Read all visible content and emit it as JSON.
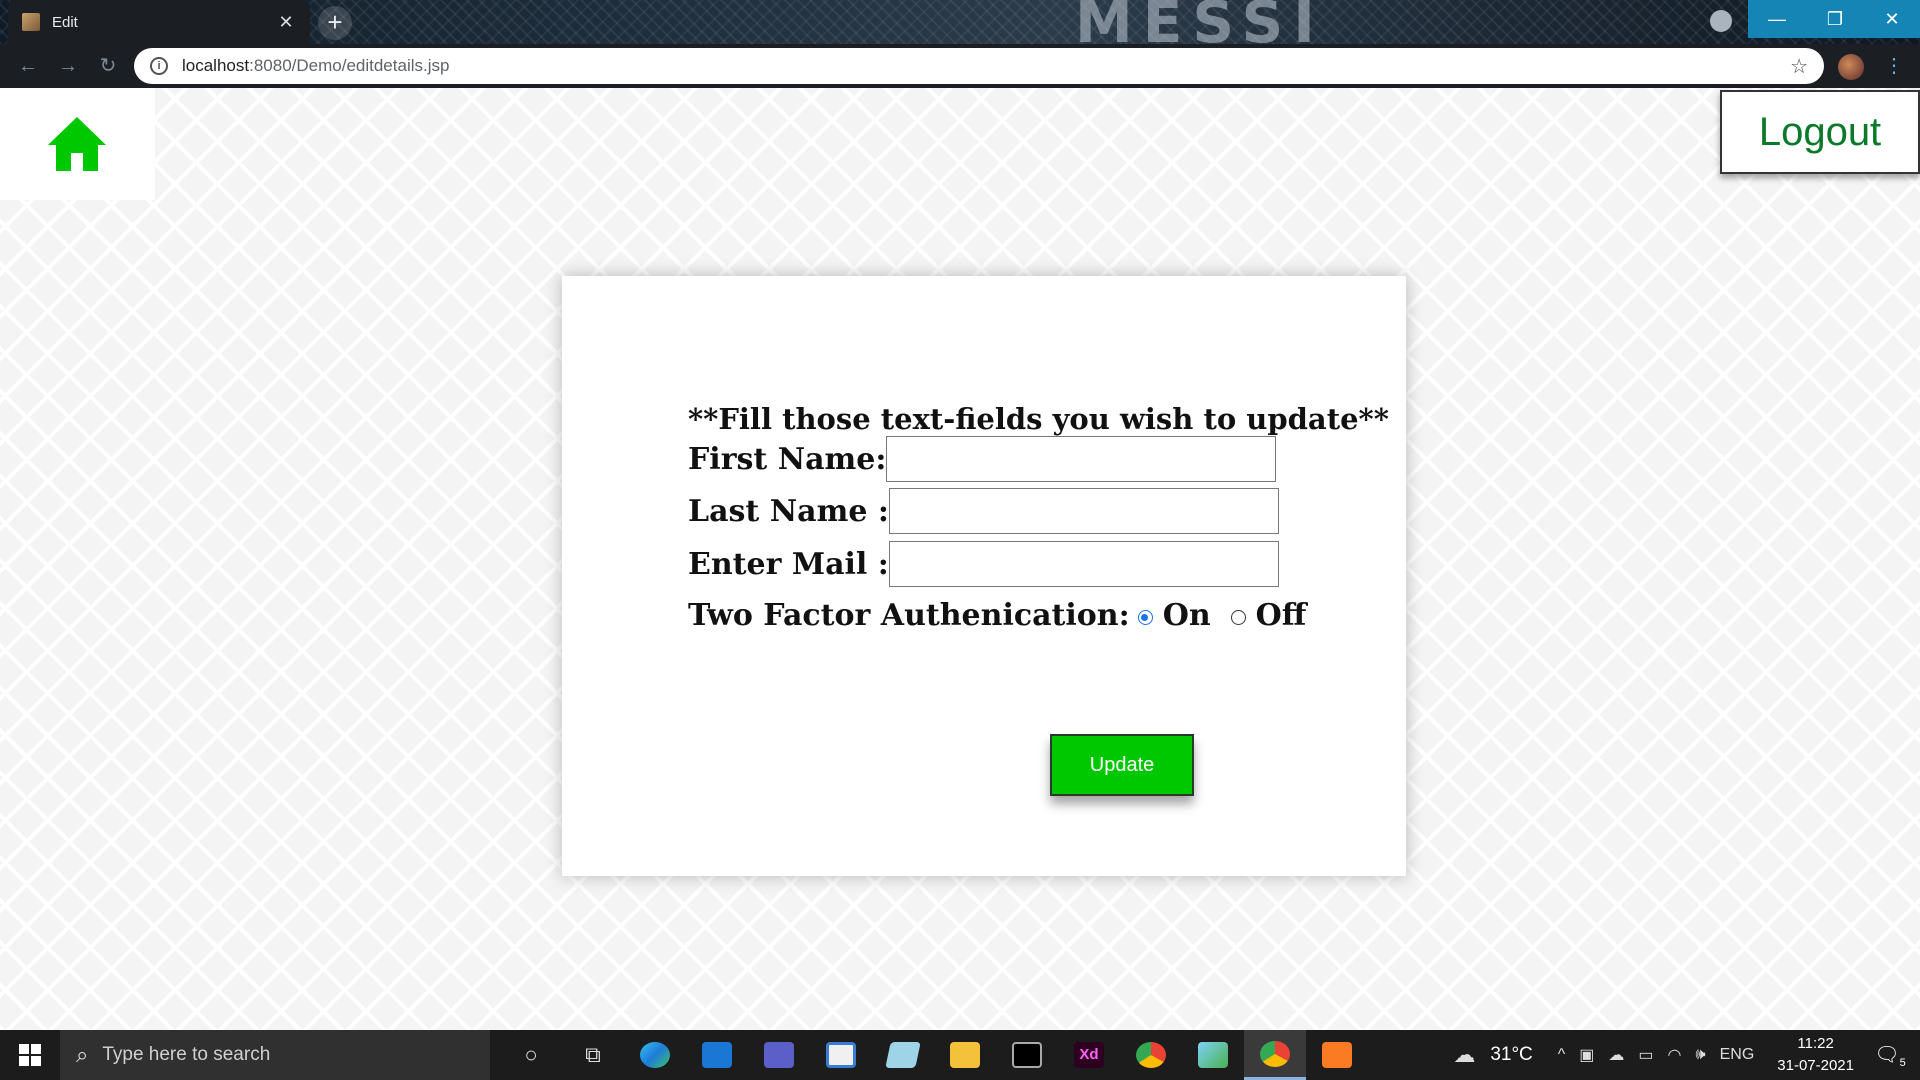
{
  "browser": {
    "tab_title": "Edit",
    "new_tab": "+",
    "url_host": "localhost",
    "url_rest": ":8080/Demo/editdetails.jsp",
    "brand_text": "MESSI"
  },
  "page": {
    "logout_label": "Logout",
    "form": {
      "heading": "**Fill those text-fields you wish to update**",
      "first_name_label": "First Name:",
      "last_name_label": "Last Name :",
      "mail_label": "Enter Mail :",
      "first_name_value": "",
      "last_name_value": "",
      "mail_value": "",
      "twofa_label": "Two Factor Authenication:",
      "twofa_options": [
        "On",
        "Off"
      ],
      "twofa_selected": "On",
      "update_label": "Update"
    },
    "colors": {
      "accent_green": "#00c800",
      "logout_text": "#0a7a2a",
      "home_icon": "#00c800"
    }
  },
  "taskbar": {
    "search_placeholder": "Type here to search",
    "weather": "31°C",
    "language": "ENG",
    "time": "11:22",
    "date": "31-07-2021",
    "notifications": "5",
    "apps": [
      "cortana-icon",
      "task-view-icon",
      "edge-icon",
      "mail-icon",
      "teams-icon",
      "store-icon",
      "notepad-icon",
      "file-explorer-icon",
      "terminal-icon",
      "adobe-xd-icon",
      "chrome-icon",
      "box-icon",
      "chrome-profile-icon",
      "xampp-icon"
    ]
  }
}
